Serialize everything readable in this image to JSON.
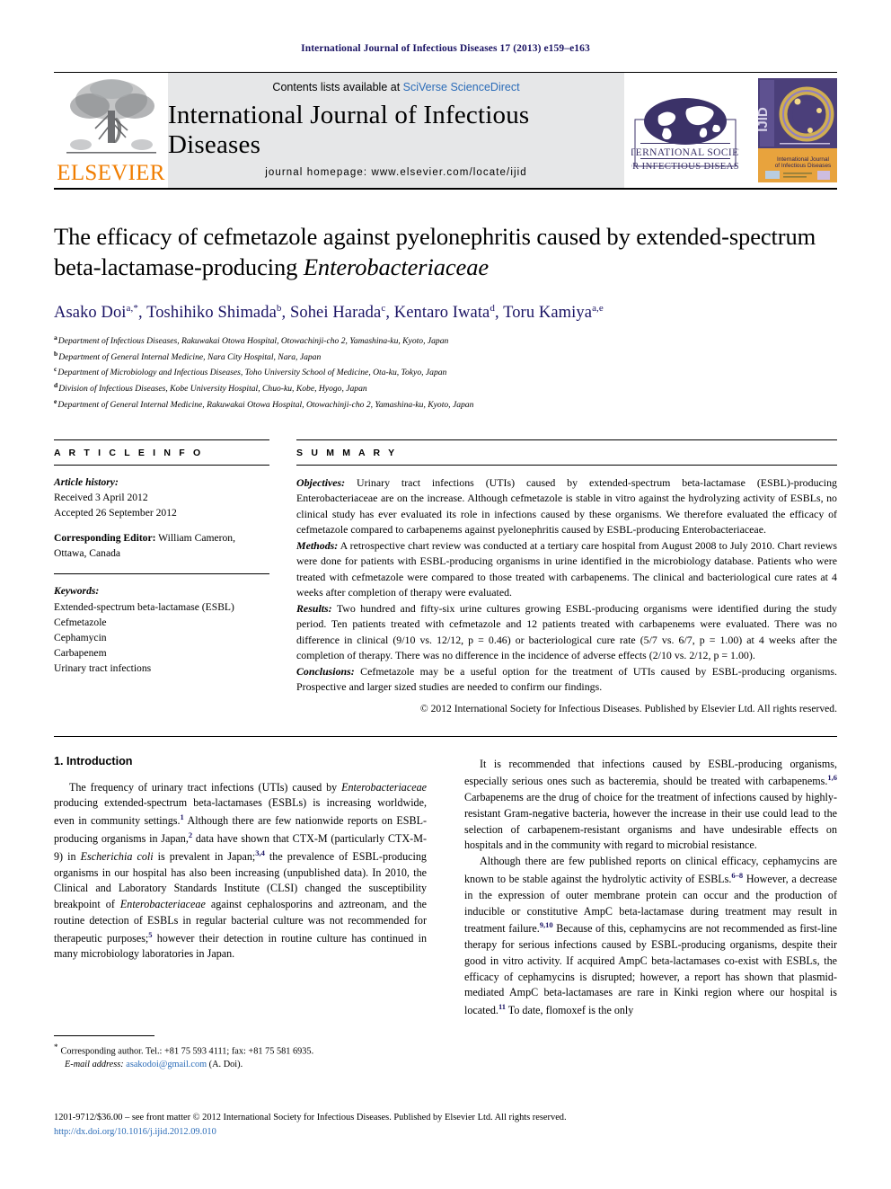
{
  "running_head": "International Journal of Infectious Diseases 17 (2013) e159–e163",
  "masthead": {
    "elsevier_wordmark": "ELSEVIER",
    "contents_prefix": "Contents lists available at ",
    "contents_link": "SciVerse ScienceDirect",
    "journal_title": "International Journal of Infectious Diseases",
    "homepage": "journal homepage: www.elsevier.com/locate/ijid",
    "isid_line1": "INTERNATIONAL SOCIETY",
    "isid_line2": "FOR INFECTIOUS DISEASES",
    "cover_spine": "IJID",
    "cover_title_line1": "International Journal",
    "cover_title_line2": "of Infectious Diseases"
  },
  "article": {
    "title_part1": "The efficacy of cefmetazole against pyelonephritis caused by extended-spectrum beta-lactamase-producing ",
    "title_italic": "Enterobacteriaceae",
    "authors": "Asako Doi a,*, Toshihiko Shimada b, Sohei Harada c, Kentaro Iwata d, Toru Kamiya a,e",
    "affiliations": [
      {
        "marker": "a",
        "text": "Department of Infectious Diseases, Rakuwakai Otowa Hospital, Otowachinji-cho 2, Yamashina-ku, Kyoto, Japan"
      },
      {
        "marker": "b",
        "text": "Department of General Internal Medicine, Nara City Hospital, Nara, Japan"
      },
      {
        "marker": "c",
        "text": "Department of Microbiology and Infectious Diseases, Toho University School of Medicine, Ota-ku, Tokyo, Japan"
      },
      {
        "marker": "d",
        "text": "Division of Infectious Diseases, Kobe University Hospital, Chuo-ku, Kobe, Hyogo, Japan"
      },
      {
        "marker": "e",
        "text": "Department of General Internal Medicine, Rakuwakai Otowa Hospital, Otowachinji-cho 2, Yamashina-ku, Kyoto, Japan"
      }
    ]
  },
  "article_info": {
    "heading": "A R T I C L E   I N F O",
    "history_label": "Article history:",
    "received": "Received 3 April 2012",
    "accepted": "Accepted 26 September 2012",
    "corresponding_editor_label": "Corresponding Editor:",
    "corresponding_editor_value": " William Cameron, Ottawa, Canada",
    "keywords_label": "Keywords:",
    "keywords": [
      "Extended-spectrum beta-lactamase (ESBL)",
      "Cefmetazole",
      "Cephamycin",
      "Carbapenem",
      "Urinary tract infections"
    ]
  },
  "summary": {
    "heading": "S U M M A R Y",
    "objectives_label": "Objectives:",
    "objectives_text": " Urinary tract infections (UTIs) caused by extended-spectrum beta-lactamase (ESBL)-producing Enterobacteriaceae are on the increase. Although cefmetazole is stable in vitro against the hydrolyzing activity of ESBLs, no clinical study has ever evaluated its role in infections caused by these organisms. We therefore evaluated the efficacy of cefmetazole compared to carbapenems against pyelonephritis caused by ESBL-producing Enterobacteriaceae.",
    "methods_label": "Methods:",
    "methods_text": " A retrospective chart review was conducted at a tertiary care hospital from August 2008 to July 2010. Chart reviews were done for patients with ESBL-producing organisms in urine identified in the microbiology database. Patients who were treated with cefmetazole were compared to those treated with carbapenems. The clinical and bacteriological cure rates at 4 weeks after completion of therapy were evaluated.",
    "results_label": "Results:",
    "results_text": " Two hundred and fifty-six urine cultures growing ESBL-producing organisms were identified during the study period. Ten patients treated with cefmetazole and 12 patients treated with carbapenems were evaluated. There was no difference in clinical (9/10 vs. 12/12, p = 0.46) or bacteriological cure rate (5/7 vs. 6/7, p = 1.00) at 4 weeks after the completion of therapy. There was no difference in the incidence of adverse effects (2/10 vs. 2/12, p = 1.00).",
    "conclusions_label": "Conclusions:",
    "conclusions_text": " Cefmetazole may be a useful option for the treatment of UTIs caused by ESBL-producing organisms. Prospective and larger sized studies are needed to confirm our findings.",
    "copyright": "© 2012 International Society for Infectious Diseases. Published by Elsevier Ltd. All rights reserved."
  },
  "body": {
    "section_title": "1. Introduction",
    "left_paragraph": "The frequency of urinary tract infections (UTIs) caused by Enterobacteriaceae producing extended-spectrum beta-lactamases (ESBLs) is increasing worldwide, even in community settings.1 Although there are few nationwide reports on ESBL-producing organisms in Japan,2 data have shown that CTX-M (particularly CTX-M-9) in Escherichia coli is prevalent in Japan;3,4 the prevalence of ESBL-producing organisms in our hospital has also been increasing (unpublished data). In 2010, the Clinical and Laboratory Standards Institute (CLSI) changed the susceptibility breakpoint of Enterobacteriaceae against cephalosporins and aztreonam, and the routine detection of ESBLs in regular bacterial culture was not recommended for therapeutic purposes;5 however their detection in routine culture has continued in many microbiology laboratories in Japan.",
    "right_paragraph_1": "It is recommended that infections caused by ESBL-producing organisms, especially serious ones such as bacteremia, should be treated with carbapenems.1,6 Carbapenems are the drug of choice for the treatment of infections caused by highly-resistant Gram-negative bacteria, however the increase in their use could lead to the selection of carbapenem-resistant organisms and have undesirable effects on hospitals and in the community with regard to microbial resistance.",
    "right_paragraph_2": "Although there are few published reports on clinical efficacy, cephamycins are known to be stable against the hydrolytic activity of ESBLs.6–8 However, a decrease in the expression of outer membrane protein can occur and the production of inducible or constitutive AmpC beta-lactamase during treatment may result in treatment failure.9,10 Because of this, cephamycins are not recommended as first-line therapy for serious infections caused by ESBL-producing organisms, despite their good in vitro activity. If acquired AmpC beta-lactamases co-exist with ESBLs, the efficacy of cephamycins is disrupted; however, a report has shown that plasmid-mediated AmpC beta-lactamases are rare in Kinki region where our hospital is located.11 To date, flomoxef is the only"
  },
  "footnote": {
    "corresponding_author": "Corresponding author. Tel.: +81 75 593 4111; fax: +81 75 581 6935.",
    "email_label": "E-mail address:",
    "email": "asakodoi@gmail.com",
    "email_suffix": " (A. Doi)."
  },
  "footer": {
    "line1": "1201-9712/$36.00 – see front matter © 2012 International Society for Infectious Diseases. Published by Elsevier Ltd. All rights reserved.",
    "doi": "http://dx.doi.org/10.1016/j.ijid.2012.09.010"
  }
}
